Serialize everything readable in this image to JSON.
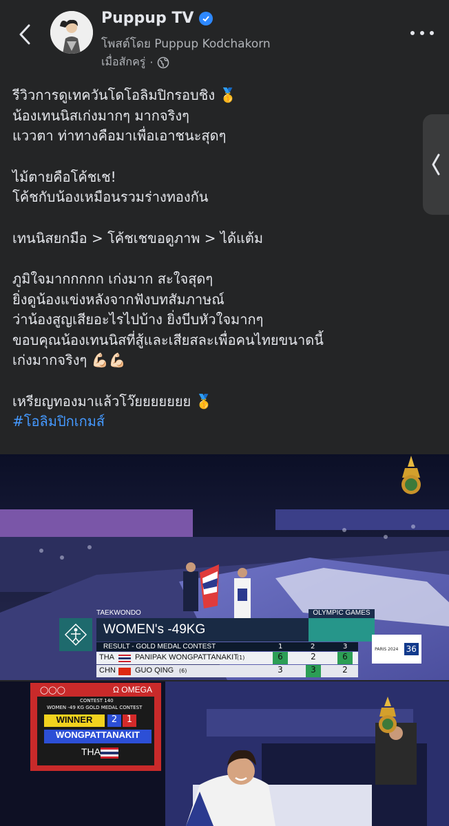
{
  "header": {
    "page_name": "Puppup TV",
    "posted_by": "โพสต์โดย Puppup Kodchakorn",
    "time": "เมื่อสักครู่",
    "dot": "·"
  },
  "post": {
    "lines_block1": [
      "รีวิวการดูเทควันโดโอลิมปิกรอบชิง 🥇",
      "น้องเทนนิสเก่งมากๆ มากจริงๆ",
      "แววตา ท่าทางคือมาเพื่อเอาชนะสุดๆ"
    ],
    "lines_block2": [
      "ไม้ตายคือโค้ชเช!",
      "โค้ชกับน้องเหมือนรวมร่างทองกัน"
    ],
    "lines_block3": [
      "เทนนิสยกมือ > โค้ชเชขอดูภาพ > ได้แต้ม"
    ],
    "lines_block4": [
      "ภูมิใจมากกกกก เก่งมาก สะใจสุดๆ",
      "ยิ่งดูน้องแข่งหลังจากฟังบทสัมภาษณ์",
      "ว่าน้องสูญเสียอะไรไปบ้าง ยิ่งบีบหัวใจมากๆ",
      "ขอบคุณน้องเทนนิสที่สู้และเสียสละเพื่อคนไทยขนาดนี้",
      "เก่งมากจริงๆ 💪🏻💪🏻"
    ],
    "lines_block5": [
      "เหรียญทองมาแล้วโว๊ยยยยยยย 🥇"
    ],
    "hashtag": "#โอลิมปิกเกมส์"
  },
  "broadcast1": {
    "sport": "TAEKWONDO",
    "games": "OLYMPIC GAMES",
    "event": "WOMEN's -49KG",
    "result_label": "RESULT - GOLD MEDAL CONTEST",
    "round_headers": [
      "1",
      "2",
      "3"
    ],
    "row1": {
      "country": "THA",
      "name": "PANIPAK WONGPATTANAKIT",
      "seed": "(1)",
      "scores": [
        "6",
        "2",
        "6"
      ]
    },
    "row2": {
      "country": "CHN",
      "name": "GUO QING",
      "seed": "(6)",
      "scores": [
        "3",
        "3",
        "2"
      ]
    },
    "paris_label": "PARIS 2024",
    "channel_label": "36"
  },
  "broadcast2": {
    "brand": "Ω OMEGA",
    "contest": "CONTEST 140",
    "event": "WOMEN -49 KG  GOLD MEDAL CONTEST",
    "winner_label": "WINNER",
    "score_a": "2",
    "score_b": "1",
    "athlete": "WONGPATTANAKIT",
    "country": "THA"
  },
  "colors": {
    "background": "#242526",
    "text": "#e4e6eb",
    "secondary": "#b0b3b8",
    "link": "#4599ff",
    "verified": "#2d88ff"
  }
}
